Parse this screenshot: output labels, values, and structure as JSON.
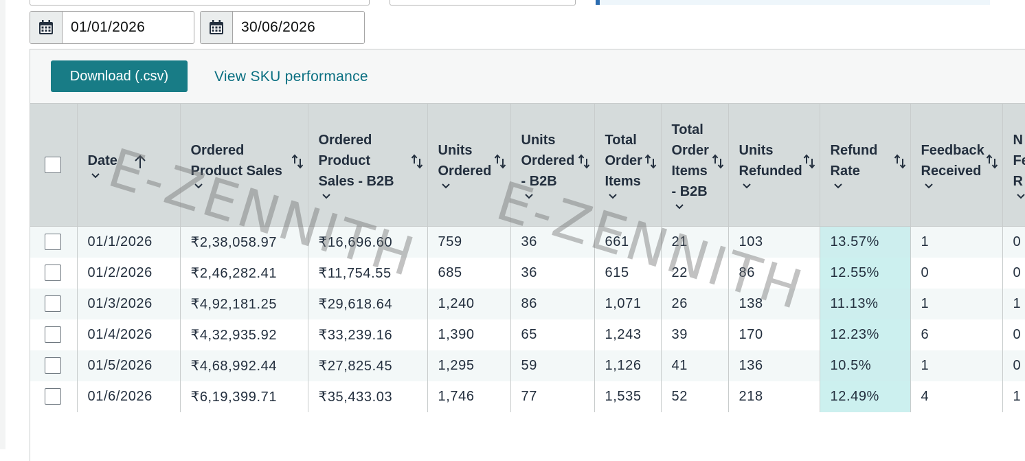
{
  "date_range": {
    "start": "01/01/2026",
    "end": "30/06/2026"
  },
  "toolbar": {
    "download_label": "Download (.csv)",
    "sku_link_label": "View SKU performance"
  },
  "watermark": "E-ZENNITH",
  "table": {
    "columns": [
      {
        "lines": [
          "Date"
        ]
      },
      {
        "lines": [
          "Ordered",
          "Product Sales"
        ]
      },
      {
        "lines": [
          "Ordered",
          "Product",
          "Sales - B2B"
        ]
      },
      {
        "lines": [
          "Units",
          "Ordered"
        ]
      },
      {
        "lines": [
          "Units",
          "Ordered",
          "- B2B"
        ]
      },
      {
        "lines": [
          "Total",
          "Order",
          "Items"
        ]
      },
      {
        "lines": [
          "Total",
          "Order",
          "Items",
          "- B2B"
        ]
      },
      {
        "lines": [
          "Units",
          "Refunded"
        ]
      },
      {
        "lines": [
          "Refund",
          "Rate"
        ]
      },
      {
        "lines": [
          "Feedback",
          "Received"
        ]
      },
      {
        "lines": [
          "N",
          "Fe",
          "R"
        ]
      }
    ],
    "rows": [
      [
        "01/1/2026",
        "₹2,38,058.97",
        "₹16,696.60",
        "759",
        "36",
        "661",
        "21",
        "103",
        "13.57%",
        "1",
        "0"
      ],
      [
        "01/2/2026",
        "₹2,46,282.41",
        "₹11,754.55",
        "685",
        "36",
        "615",
        "22",
        "86",
        "12.55%",
        "0",
        "0"
      ],
      [
        "01/3/2026",
        "₹4,92,181.25",
        "₹29,618.64",
        "1,240",
        "86",
        "1,071",
        "26",
        "138",
        "11.13%",
        "1",
        "1"
      ],
      [
        "01/4/2026",
        "₹4,32,935.92",
        "₹33,239.16",
        "1,390",
        "65",
        "1,243",
        "39",
        "170",
        "12.23%",
        "6",
        "0"
      ],
      [
        "01/5/2026",
        "₹4,68,992.44",
        "₹27,825.45",
        "1,295",
        "59",
        "1,126",
        "41",
        "136",
        "10.5%",
        "1",
        "0"
      ],
      [
        "01/6/2026",
        "₹6,19,399.71",
        "₹35,433.03",
        "1,746",
        "77",
        "1,535",
        "52",
        "218",
        "12.49%",
        "4",
        "1"
      ]
    ]
  }
}
